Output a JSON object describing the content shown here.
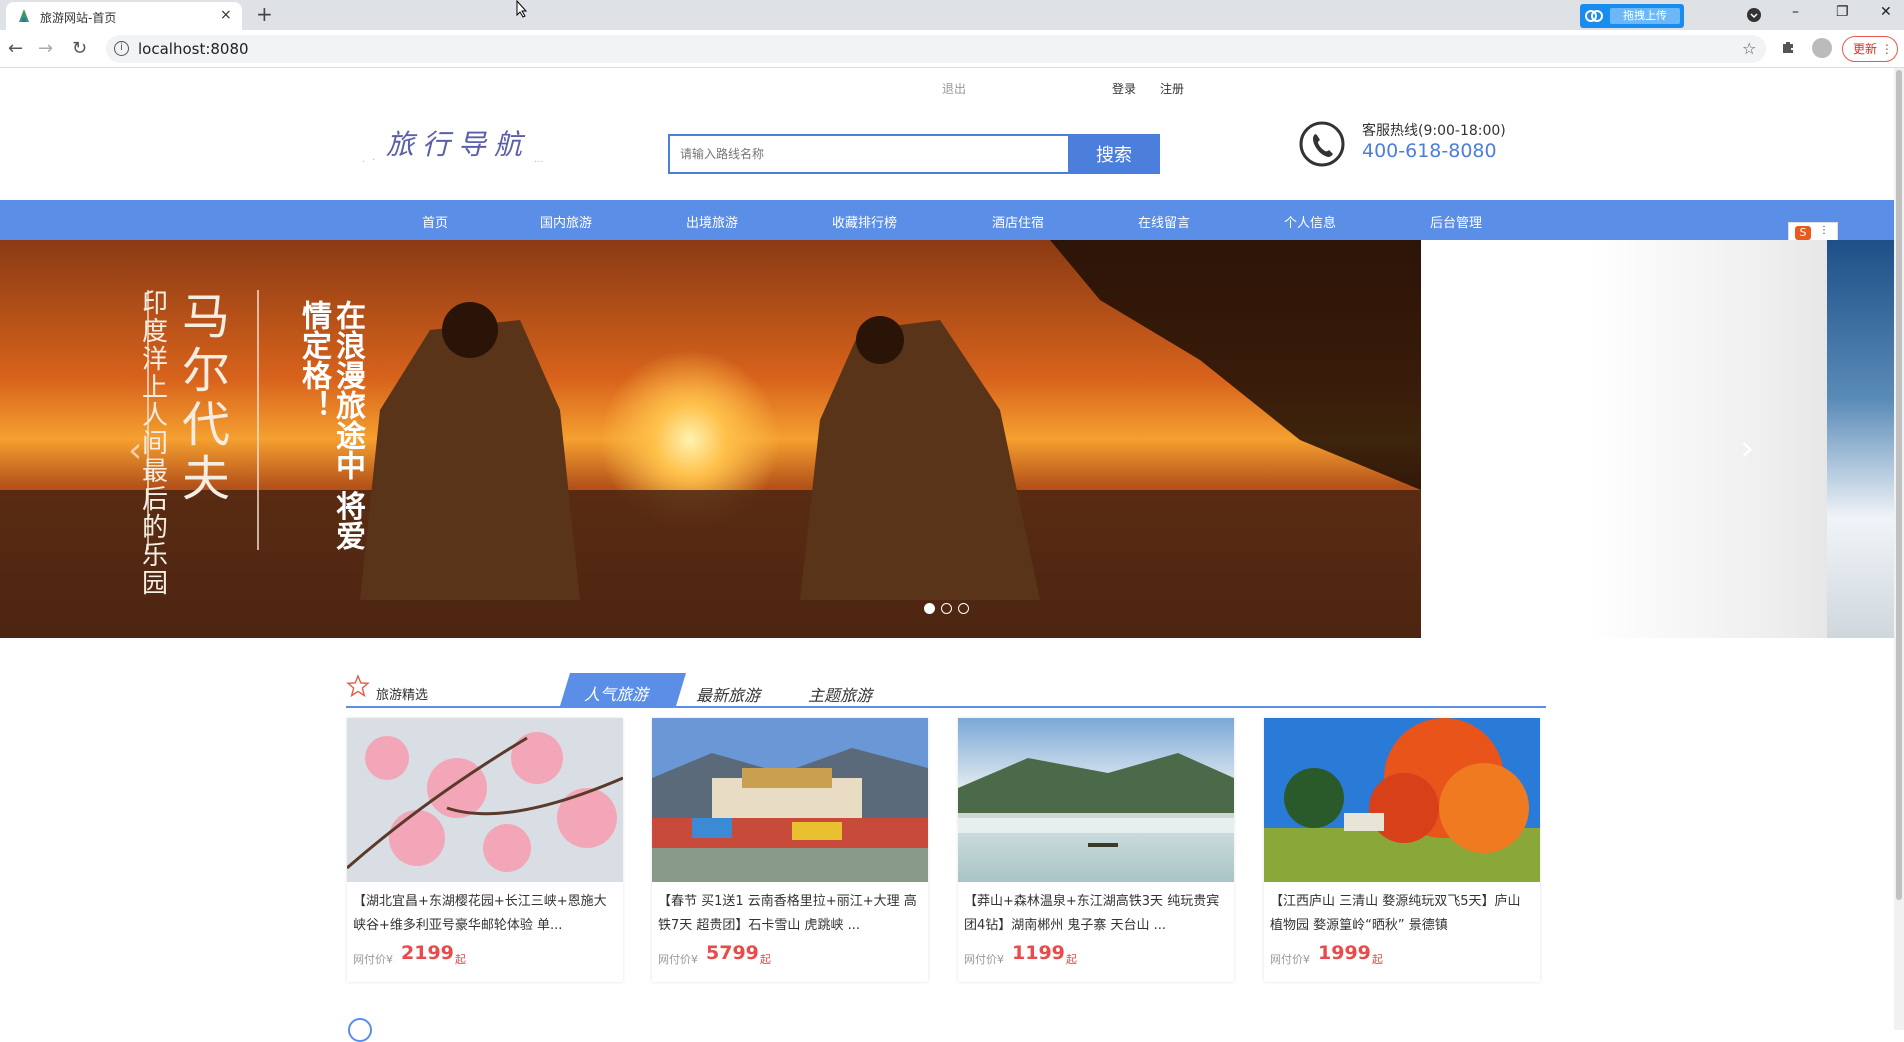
{
  "browser": {
    "tab_title": "旅游网站-首页",
    "tab_close": "×",
    "new_tab": "+",
    "upload_label": "拖拽上传",
    "url": "localhost:8080",
    "update_label": "更新",
    "icons": [
      "back-icon",
      "forward-icon",
      "reload-icon",
      "info-icon",
      "star-icon",
      "extensions-icon",
      "profile-icon",
      "minimize-icon",
      "restore-icon",
      "close-icon"
    ]
  },
  "header": {
    "logout": "退出",
    "login": "登录",
    "register": "注册",
    "logo_text": "旅行导航",
    "search_placeholder": "请输入路线名称",
    "search_button": "搜索",
    "hotline_label": "客服热线(9:00-18:00)",
    "hotline_number": "400-618-8080"
  },
  "nav": {
    "items": [
      "首页",
      "国内旅游",
      "出境旅游",
      "收藏排行榜",
      "酒店住宿",
      "在线留言",
      "个人信息",
      "后台管理"
    ]
  },
  "banner": {
    "slides_count": 3,
    "active_slide": 1,
    "prev": "‹",
    "next": "›",
    "text_title": "马尔代夫",
    "text_sub": "印度洋上人间最后的乐园",
    "text_slogan": "在浪漫旅途中 将爱情定格！"
  },
  "section": {
    "title": "旅游精选",
    "tabs": [
      "人气旅游",
      "最新旅游",
      "主题旅游"
    ],
    "active_tab": 0,
    "price_prefix": "网付价¥",
    "price_suffix": "起",
    "cards": [
      {
        "desc": "【湖北宜昌+东湖樱花园+长江三峡+恩施大峡谷+维多利亚号豪华邮轮体验 单...",
        "price": "2199"
      },
      {
        "desc": "【春节 买1送1 云南香格里拉+丽江+大理 高铁7天 超贵团】石卡雪山 虎跳峡 ...",
        "price": "5799"
      },
      {
        "desc": "【莽山+森林温泉+东江湖高铁3天 纯玩贵宾团4钻】湖南郴州 鬼子寨 天台山 ...",
        "price": "1199"
      },
      {
        "desc": "【江西庐山 三清山 婺源纯玩双飞5天】庐山植物园 婺源篁岭“晒秋” 景德镇",
        "price": "1999"
      }
    ]
  },
  "colors": {
    "primary_blue": "#5b8ee6",
    "search_blue": "#4c7fdc",
    "price_red": "#e94a4a",
    "hotline_blue": "#4c7fdc"
  }
}
